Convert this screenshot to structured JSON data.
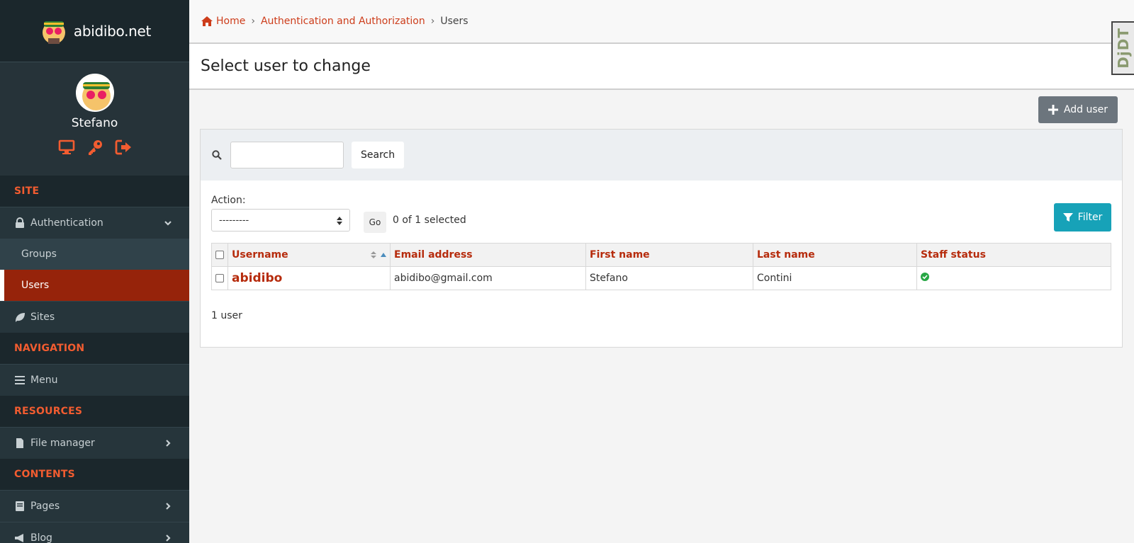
{
  "brand": {
    "name": "abidibo.net",
    "logo_icon": "avatar-logo-icon"
  },
  "user": {
    "name": "Stefano",
    "actions": [
      "monitor-icon",
      "key-icon",
      "sign-out-icon"
    ]
  },
  "sidebar": {
    "sections": [
      {
        "title": "SITE"
      },
      {
        "title": "NAVIGATION"
      },
      {
        "title": "RESOURCES"
      },
      {
        "title": "CONTENTS"
      }
    ],
    "items": {
      "authentication": "Authentication",
      "groups": "Groups",
      "users": "Users",
      "sites": "Sites",
      "menu": "Menu",
      "file_manager": "File manager",
      "pages": "Pages",
      "blog": "Blog"
    }
  },
  "breadcrumb": {
    "home": "Home",
    "app": "Authentication and Authorization",
    "current": "Users",
    "separator": "›"
  },
  "page": {
    "title": "Select user to change",
    "add_button": "Add user",
    "djdt": "DjDT"
  },
  "search": {
    "button": "Search",
    "placeholder": ""
  },
  "actions": {
    "label": "Action:",
    "selected_option": "---------",
    "go": "Go",
    "selected_count": "0 of 1 selected",
    "filter": "Filter"
  },
  "table": {
    "headers": [
      "Username",
      "Email address",
      "First name",
      "Last name",
      "Staff status"
    ],
    "rows": [
      {
        "username": "abidibo",
        "email": "abidibo@gmail.com",
        "first_name": "Stefano",
        "last_name": "Contini",
        "staff_status": true
      }
    ]
  },
  "result_count": "1 user",
  "colors": {
    "accent": "#f25c30",
    "link": "#cd3d1b",
    "header_red": "#b62b0c",
    "filter": "#17a2b8",
    "active_nav": "#96230a",
    "sidebar": "#1f2d33"
  }
}
